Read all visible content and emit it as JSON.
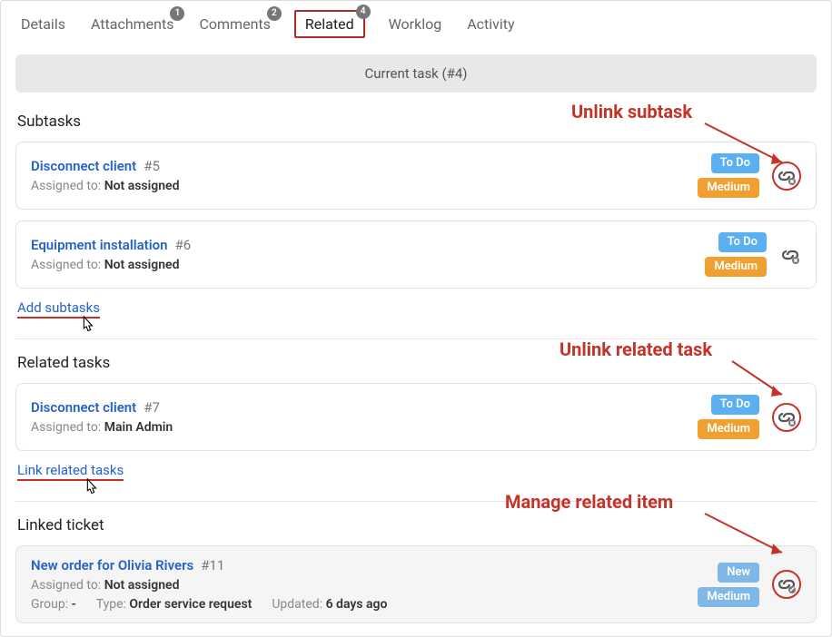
{
  "tabs": [
    {
      "label": "Details",
      "badge": null
    },
    {
      "label": "Attachments",
      "badge": "1"
    },
    {
      "label": "Comments",
      "badge": "2"
    },
    {
      "label": "Related",
      "badge": "4",
      "active": true
    },
    {
      "label": "Worklog",
      "badge": null
    },
    {
      "label": "Activity",
      "badge": null
    }
  ],
  "current_banner": "Current task (#4)",
  "sections": {
    "subtasks": {
      "heading": "Subtasks",
      "action_link": "Add subtasks",
      "items": [
        {
          "title": "Disconnect client",
          "ref": "#5",
          "assigned_label": "Assigned to:",
          "assigned_value": "Not assigned",
          "status": "To Do",
          "priority": "Medium"
        },
        {
          "title": "Equipment installation",
          "ref": "#6",
          "assigned_label": "Assigned to:",
          "assigned_value": "Not assigned",
          "status": "To Do",
          "priority": "Medium"
        }
      ]
    },
    "related": {
      "heading": "Related tasks",
      "action_link": "Link related tasks",
      "items": [
        {
          "title": "Disconnect client",
          "ref": "#7",
          "assigned_label": "Assigned to:",
          "assigned_value": "Main Admin",
          "status": "To Do",
          "priority": "Medium"
        }
      ]
    },
    "ticket": {
      "heading": "Linked ticket",
      "items": [
        {
          "title": "New order for Olivia Rivers",
          "ref": "#11",
          "assigned_label": "Assigned to:",
          "assigned_value": "Not assigned",
          "group_label": "Group:",
          "group_value": "-",
          "type_label": "Type:",
          "type_value": "Order service request",
          "updated_label": "Updated:",
          "updated_value": "6 days ago",
          "status": "New",
          "priority": "Medium"
        }
      ]
    }
  },
  "annotations": {
    "unlink_subtask": "Unlink subtask",
    "unlink_related": "Unlink related task",
    "manage_item": "Manage related item"
  }
}
